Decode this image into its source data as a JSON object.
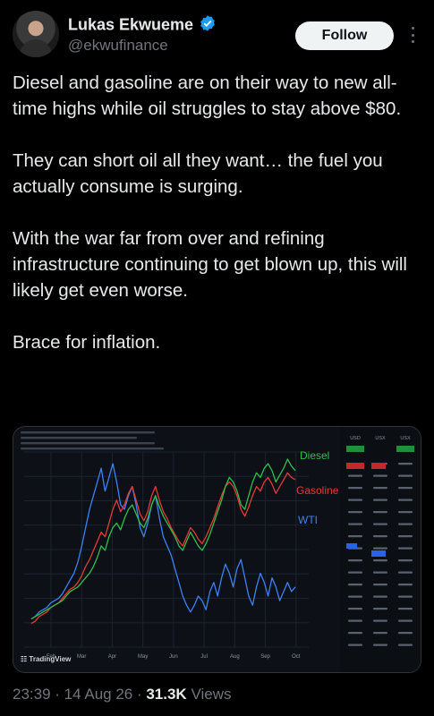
{
  "author": {
    "name": "Lukas Ekwueme",
    "handle": "@ekwufinance",
    "follow_label": "Follow"
  },
  "tweet": {
    "paragraphs": [
      "Diesel and gasoline are on their way to new all-time highs while oil struggles to stay above $80.",
      "They can short oil all they want… the fuel you actually consume is surging.",
      "With the war far from over and refining infrastructure continuing to get blown up, this will likely get even worse.",
      "Brace for inflation."
    ]
  },
  "meta": {
    "time": "23:39",
    "date": "14 Aug 26",
    "views_count": "31.3K",
    "views_label": "Views"
  },
  "chart_data": {
    "type": "line",
    "brand": "TradingView",
    "x_ticks": [
      "Feb",
      "Mar",
      "Apr",
      "May",
      "Jun",
      "Jul",
      "Aug",
      "Sep",
      "Oct"
    ],
    "series": [
      {
        "name": "Diesel",
        "color": "#2fbf4a",
        "values": [
          30,
          31,
          32,
          33,
          34,
          35,
          36,
          37,
          38,
          40,
          42,
          43,
          44,
          46,
          48,
          50,
          53,
          57,
          62,
          60,
          66,
          70,
          72,
          69,
          74,
          78,
          80,
          76,
          72,
          70,
          74,
          80,
          84,
          79,
          75,
          72,
          69,
          66,
          62,
          60,
          64,
          68,
          65,
          62,
          60,
          63,
          67,
          72,
          77,
          82,
          88,
          92,
          90,
          86,
          80,
          78,
          84,
          90,
          94,
          92,
          96,
          98,
          95,
          90,
          93,
          96,
          100,
          97,
          95
        ]
      },
      {
        "name": "Gasoline",
        "color": "#e53935",
        "values": [
          28,
          29,
          31,
          32,
          33,
          35,
          36,
          37,
          39,
          41,
          43,
          44,
          46,
          49,
          53,
          56,
          60,
          64,
          68,
          66,
          72,
          78,
          82,
          77,
          80,
          85,
          88,
          82,
          76,
          73,
          77,
          84,
          88,
          82,
          77,
          74,
          70,
          67,
          64,
          62,
          66,
          70,
          68,
          65,
          63,
          66,
          70,
          74,
          79,
          84,
          88,
          90,
          88,
          84,
          78,
          75,
          79,
          84,
          88,
          86,
          90,
          92,
          89,
          85,
          88,
          91,
          94,
          92,
          91
        ]
      },
      {
        "name": "WTI",
        "color": "#3b82f6",
        "values": [
          30,
          31,
          33,
          34,
          35,
          37,
          38,
          39,
          41,
          44,
          47,
          50,
          55,
          62,
          70,
          78,
          84,
          90,
          96,
          86,
          92,
          98,
          90,
          80,
          78,
          84,
          88,
          80,
          70,
          66,
          72,
          80,
          84,
          74,
          66,
          62,
          58,
          52,
          46,
          40,
          36,
          33,
          36,
          40,
          38,
          34,
          42,
          46,
          40,
          48,
          54,
          50,
          44,
          52,
          56,
          48,
          40,
          36,
          44,
          50,
          46,
          40,
          48,
          44,
          38,
          42,
          46,
          42,
          44
        ]
      }
    ],
    "y_axis_ticks": [
      "USD",
      "USX",
      "USX"
    ],
    "grid": true,
    "legend": "labels-at-right"
  }
}
